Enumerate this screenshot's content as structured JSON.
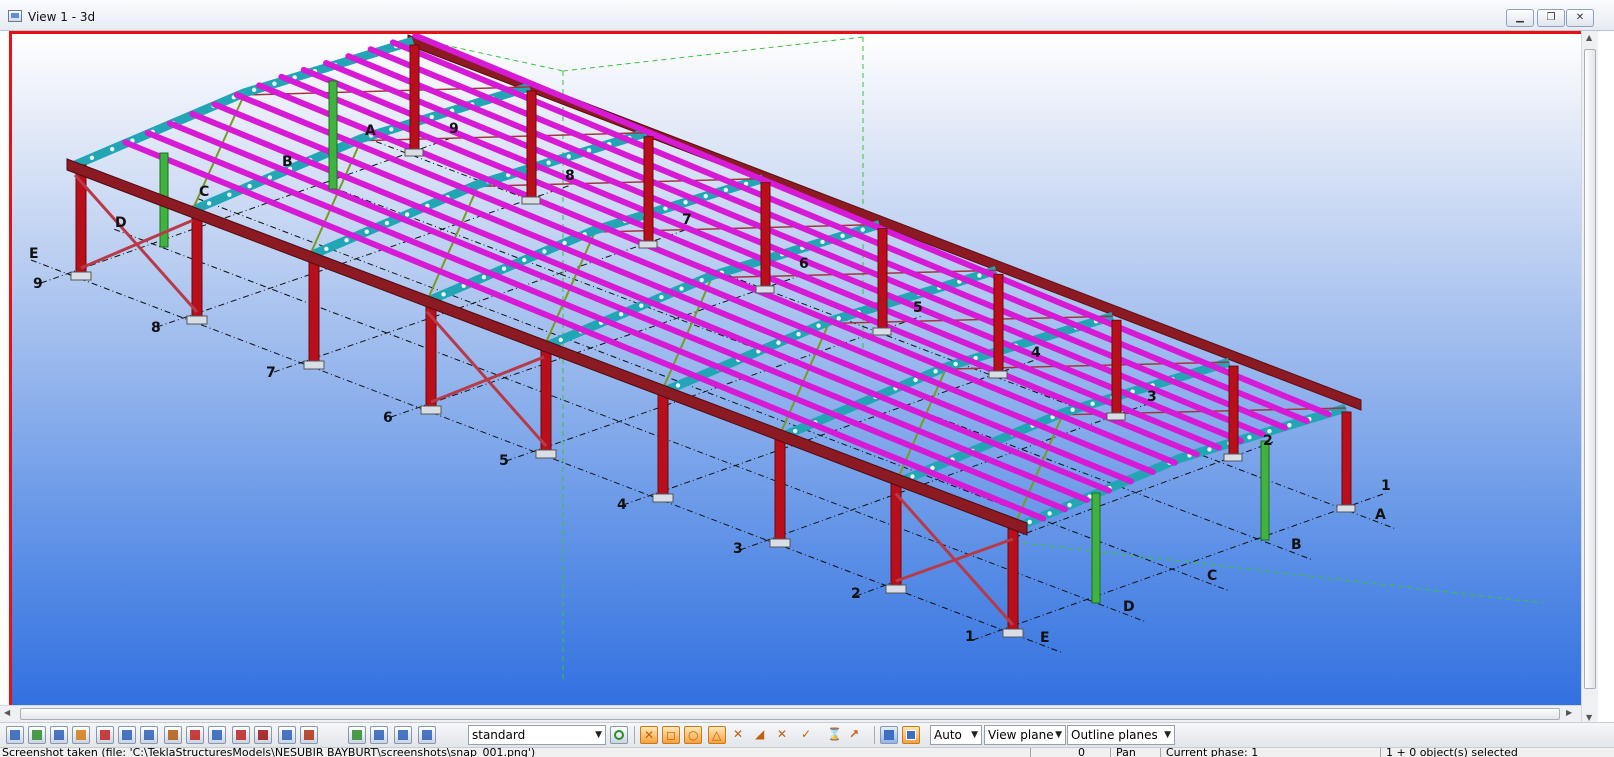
{
  "window": {
    "title": "View 1 - 3d",
    "buttons": {
      "minimize": "▭",
      "restore": "▭",
      "close": "✕"
    }
  },
  "viewport": {
    "border_color": "#e81010",
    "grid_labels": {
      "rows_left": [
        "9",
        "8",
        "7",
        "6",
        "5",
        "4",
        "3",
        "2",
        "1"
      ],
      "rows_top": [
        "9",
        "8",
        "7",
        "6",
        "5",
        "4",
        "3",
        "2",
        "1"
      ],
      "axes_left": [
        "E",
        "D",
        "C",
        "B",
        "A"
      ],
      "axes_right": [
        "A",
        "B",
        "C",
        "D",
        "E"
      ]
    },
    "colors": {
      "columns": "#b80f1b",
      "rafters": "#22a6b6",
      "purlins": "#d61ad6",
      "eave_beam": "#8b1a23",
      "green_members": "#3fb23f"
    }
  },
  "toolbar": {
    "icons": [
      "select-all-icon",
      "select-parts-icon",
      "select-surface-icon",
      "select-welds-icon",
      "select-grid-icon",
      "select-points-icon",
      "select-cut-icon",
      "select-components-icon",
      "select-assembly-icon",
      "select-views-icon",
      "select-planes-icon",
      "select-bolts-icon",
      "select-rebar-icon",
      "select-lines-icon",
      "snap-ref-icon",
      "snap-geometry-icon",
      "snap-nearest-icon",
      "snap-any-icon"
    ],
    "filter_value": "standard",
    "snap_icons": [
      "snap-end-icon",
      "snap-center-icon",
      "snap-intersection-icon",
      "snap-mid-icon",
      "snap-nearest-point-icon",
      "snap-perpendicular-icon",
      "snap-extension-icon",
      "snap-line-icon",
      "snap-free-icon",
      "snap-arrow-icon"
    ],
    "depth_value": "Auto",
    "plane_value": "View plane",
    "outline_value": "Outline planes"
  },
  "statusbar": {
    "message": "Screenshot taken (file: 'C:\\TeklaStructuresModels\\NESUBIR BAYBURT\\screenshots\\snap_001.png')",
    "count": "0",
    "mode": "Pan",
    "phase": "Current phase: 1",
    "selection": "1 + 0 object(s) selected"
  }
}
